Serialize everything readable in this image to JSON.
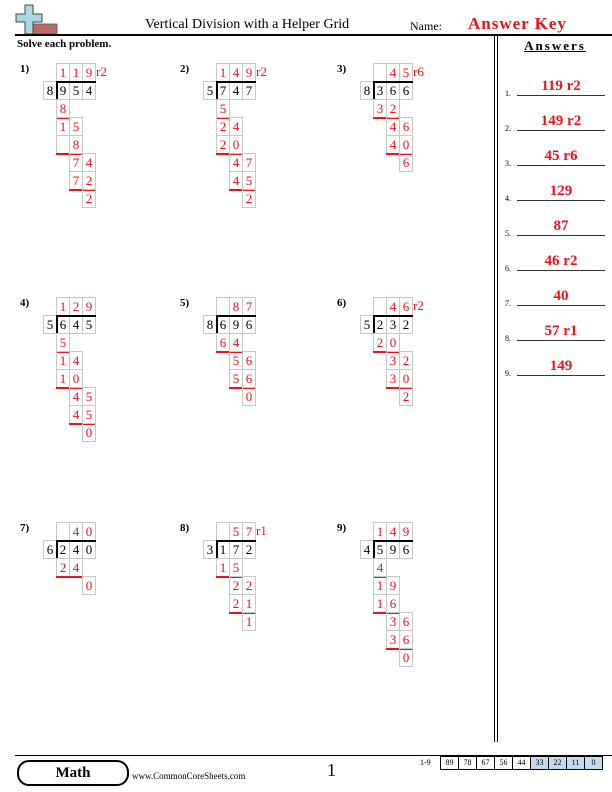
{
  "header": {
    "title": "Vertical Division with a Helper Grid",
    "name_label": "Name:",
    "name_value": "Answer Key",
    "logo_icon": "plus-sign-logo-icon",
    "instructions": "Solve each problem."
  },
  "answers_panel": {
    "title": "Answers",
    "items": [
      {
        "num": "1.",
        "value": "119 r2"
      },
      {
        "num": "2.",
        "value": "149 r2"
      },
      {
        "num": "3.",
        "value": "45 r6"
      },
      {
        "num": "4.",
        "value": "129"
      },
      {
        "num": "5.",
        "value": "87"
      },
      {
        "num": "6.",
        "value": "46 r2"
      },
      {
        "num": "7.",
        "value": "40"
      },
      {
        "num": "8.",
        "value": "57 r1"
      },
      {
        "num": "9.",
        "value": "149"
      }
    ]
  },
  "problems": [
    {
      "label": "1)",
      "divisor": "8",
      "dividend": [
        "9",
        "5",
        "4"
      ],
      "quotient": [
        "1",
        "1",
        "9"
      ],
      "remainder": "r2",
      "steps": [
        [
          "8"
        ],
        [
          "1",
          "5"
        ],
        [
          "",
          "8"
        ],
        [
          "7",
          "4"
        ],
        [
          "7",
          "2"
        ],
        [
          "2"
        ]
      ]
    },
    {
      "label": "2)",
      "divisor": "5",
      "dividend": [
        "7",
        "4",
        "7"
      ],
      "quotient": [
        "1",
        "4",
        "9"
      ],
      "remainder": "r2",
      "steps": [
        [
          "5"
        ],
        [
          "2",
          "4"
        ],
        [
          "2",
          "0"
        ],
        [
          "4",
          "7"
        ],
        [
          "4",
          "5"
        ],
        [
          "2"
        ]
      ]
    },
    {
      "label": "3)",
      "divisor": "8",
      "dividend": [
        "3",
        "6",
        "6"
      ],
      "quotient": [
        "",
        "4",
        "5"
      ],
      "remainder": "r6",
      "steps": [
        [
          "3",
          "2"
        ],
        [
          "4",
          "6"
        ],
        [
          "4",
          "0"
        ],
        [
          "6"
        ]
      ]
    },
    {
      "label": "4)",
      "divisor": "5",
      "dividend": [
        "6",
        "4",
        "5"
      ],
      "quotient": [
        "1",
        "2",
        "9"
      ],
      "remainder": "",
      "steps": [
        [
          "5"
        ],
        [
          "1",
          "4"
        ],
        [
          "1",
          "0"
        ],
        [
          "4",
          "5"
        ],
        [
          "4",
          "5"
        ],
        [
          "0"
        ]
      ]
    },
    {
      "label": "5)",
      "divisor": "8",
      "dividend": [
        "6",
        "9",
        "6"
      ],
      "quotient": [
        "",
        "8",
        "7"
      ],
      "remainder": "",
      "steps": [
        [
          "6",
          "4"
        ],
        [
          "5",
          "6"
        ],
        [
          "5",
          "6"
        ],
        [
          "0"
        ]
      ]
    },
    {
      "label": "6)",
      "divisor": "5",
      "dividend": [
        "2",
        "3",
        "2"
      ],
      "quotient": [
        "",
        "4",
        "6"
      ],
      "remainder": "r2",
      "steps": [
        [
          "2",
          "0"
        ],
        [
          "3",
          "2"
        ],
        [
          "3",
          "0"
        ],
        [
          "2"
        ]
      ]
    },
    {
      "label": "7)",
      "divisor": "6",
      "dividend": [
        "2",
        "4",
        "0"
      ],
      "quotient": [
        "",
        "4",
        "0"
      ],
      "remainder": "",
      "steps": [
        [
          "2",
          "4"
        ],
        [
          "0"
        ]
      ]
    },
    {
      "label": "8)",
      "divisor": "3",
      "dividend": [
        "1",
        "7",
        "2"
      ],
      "quotient": [
        "",
        "5",
        "7"
      ],
      "remainder": "r1",
      "steps": [
        [
          "1",
          "5"
        ],
        [
          "2",
          "2"
        ],
        [
          "2",
          "1"
        ],
        [
          "1"
        ]
      ]
    },
    {
      "label": "9)",
      "divisor": "4",
      "dividend": [
        "5",
        "9",
        "6"
      ],
      "quotient": [
        "1",
        "4",
        "9"
      ],
      "remainder": "",
      "steps": [
        [
          "4"
        ],
        [
          "1",
          "9"
        ],
        [
          "1",
          "6"
        ],
        [
          "3",
          "6"
        ],
        [
          "3",
          "6"
        ],
        [
          "0"
        ]
      ]
    }
  ],
  "footer": {
    "subject": "Math",
    "site": "www.CommonCoreSheets.com",
    "page": "1",
    "score_label": "1-9",
    "scores": [
      "89",
      "78",
      "67",
      "56",
      "44",
      "33",
      "22",
      "11",
      "0"
    ],
    "highlight_color": "#c5d9f1"
  },
  "colors": {
    "answer_red": "#e8131b"
  }
}
